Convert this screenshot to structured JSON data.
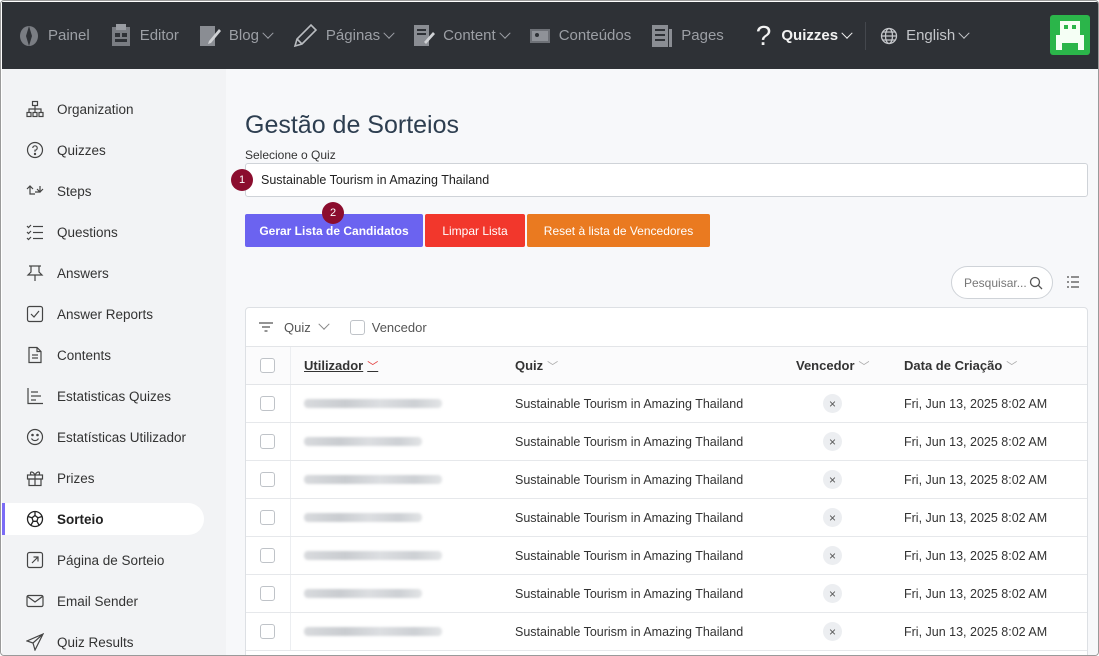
{
  "topbar": {
    "items": [
      {
        "label": "Painel",
        "icon": "painel-icon"
      },
      {
        "label": "Editor",
        "icon": "editor-icon"
      },
      {
        "label": "Blog",
        "icon": "blog-icon",
        "dropdown": true
      },
      {
        "label": "Páginas",
        "icon": "pencil-icon",
        "dropdown": true
      },
      {
        "label": "Content",
        "icon": "content-icon",
        "dropdown": true
      },
      {
        "label": "Conteúdos",
        "icon": "conteudos-icon"
      },
      {
        "label": "Pages",
        "icon": "pages-icon"
      },
      {
        "label": "Quizzes",
        "icon": "question-icon",
        "dropdown": true,
        "active": true
      },
      {
        "label": "English",
        "icon": "globe-icon",
        "dropdown": true
      }
    ]
  },
  "sidebar": {
    "items": [
      {
        "label": "Organization",
        "icon": "organization-icon"
      },
      {
        "label": "Quizzes",
        "icon": "question-circle-icon"
      },
      {
        "label": "Steps",
        "icon": "steps-icon"
      },
      {
        "label": "Questions",
        "icon": "questions-list-icon"
      },
      {
        "label": "Answers",
        "icon": "pin-icon"
      },
      {
        "label": "Answer Reports",
        "icon": "checkbox-icon"
      },
      {
        "label": "Contents",
        "icon": "document-icon"
      },
      {
        "label": "Estatisticas Quizes",
        "icon": "stats-icon"
      },
      {
        "label": "Estatísticas Utilizador",
        "icon": "smile-icon"
      },
      {
        "label": "Prizes",
        "icon": "gift-icon"
      },
      {
        "label": "Sorteio",
        "icon": "ball-icon",
        "active": true
      },
      {
        "label": "Página de Sorteio",
        "icon": "external-link-icon"
      },
      {
        "label": "Email Sender",
        "icon": "mail-icon"
      },
      {
        "label": "Quiz Results",
        "icon": "send-icon"
      }
    ]
  },
  "main": {
    "title": "Gestão de Sorteios",
    "select_label": "Selecione o Quiz",
    "selected_quiz": "Sustainable Tourism in Amazing Thailand",
    "badges": [
      "1",
      "2"
    ],
    "buttons": {
      "generate": "Gerar Lista de Candidatos",
      "clear": "Limpar Lista",
      "reset": "Reset à lista de Vencedores"
    },
    "search_placeholder": "Pesquisar...",
    "filters": {
      "quiz": "Quiz",
      "winner": "Vencedor"
    },
    "columns": [
      "Utilizador",
      "Quiz",
      "Vencedor",
      "Data de Criação"
    ],
    "rows": [
      {
        "quiz": "Sustainable Tourism in Amazing Thailand",
        "winner": "×",
        "date": "Fri, Jun 13, 2025 8:02 AM"
      },
      {
        "quiz": "Sustainable Tourism in Amazing Thailand",
        "winner": "×",
        "date": "Fri, Jun 13, 2025 8:02 AM"
      },
      {
        "quiz": "Sustainable Tourism in Amazing Thailand",
        "winner": "×",
        "date": "Fri, Jun 13, 2025 8:02 AM"
      },
      {
        "quiz": "Sustainable Tourism in Amazing Thailand",
        "winner": "×",
        "date": "Fri, Jun 13, 2025 8:02 AM"
      },
      {
        "quiz": "Sustainable Tourism in Amazing Thailand",
        "winner": "×",
        "date": "Fri, Jun 13, 2025 8:02 AM"
      },
      {
        "quiz": "Sustainable Tourism in Amazing Thailand",
        "winner": "×",
        "date": "Fri, Jun 13, 2025 8:02 AM"
      },
      {
        "quiz": "Sustainable Tourism in Amazing Thailand",
        "winner": "×",
        "date": "Fri, Jun 13, 2025 8:02 AM"
      }
    ]
  },
  "colors": {
    "topbar": "#2e3136",
    "primary": "#6b63f0",
    "danger": "#f2372c",
    "warning": "#ea7a20",
    "badge": "#8b0d2e",
    "avatar": "#2bb54a"
  }
}
